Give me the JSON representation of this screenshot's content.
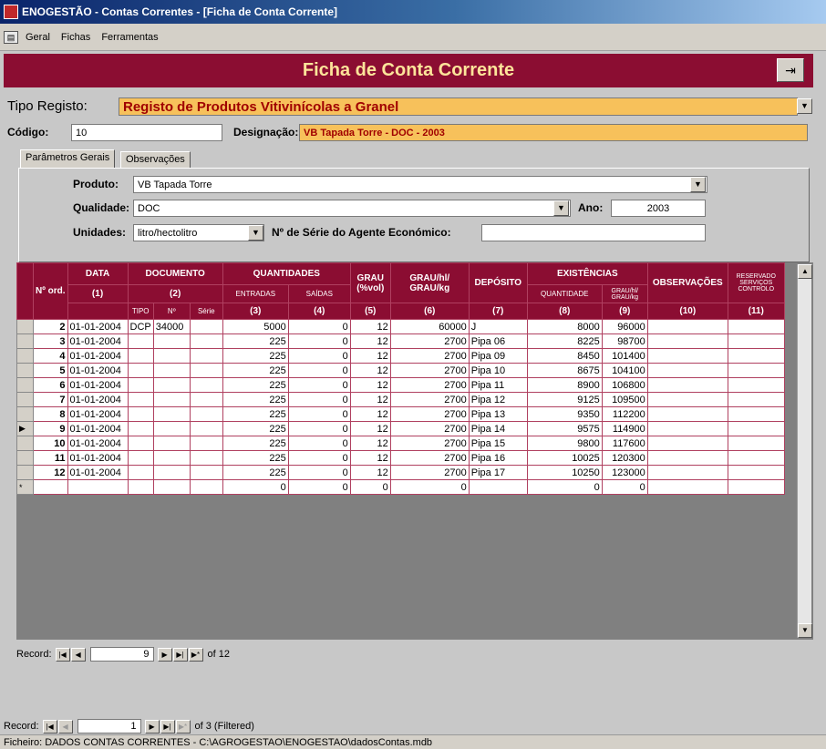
{
  "window": {
    "title": "ENOGESTÃO - Contas Correntes - [Ficha de Conta Corrente]"
  },
  "menu": [
    "Geral",
    "Fichas",
    "Ferramentas"
  ],
  "header": {
    "title": "Ficha de Conta Corrente"
  },
  "form": {
    "tipo_registo_label": "Tipo Registo:",
    "tipo_registo_value": "Registo de Produtos Vitivinícolas a Granel",
    "codigo_label": "Código:",
    "codigo_value": "10",
    "designacao_label": "Designação:",
    "designacao_value": "VB Tapada Torre - DOC - 2003"
  },
  "tabs": [
    "Parâmetros Gerais",
    "Observações"
  ],
  "params": {
    "produto_label": "Produto:",
    "produto_value": "VB Tapada Torre",
    "qualidade_label": "Qualidade:",
    "qualidade_value": "DOC",
    "ano_label": "Ano:",
    "ano_value": "2003",
    "unidades_label": "Unidades:",
    "unidades_value": "litro/hectolitro",
    "nserie_label": "Nº de Série do Agente Económico:",
    "nserie_value": ""
  },
  "grid": {
    "headers": {
      "nord": "Nº ord.",
      "data": "DATA",
      "data_num": "(1)",
      "documento": "DOCUMENTO",
      "documento_num": "(2)",
      "tipo": "TIPO",
      "n": "Nº",
      "serie": "Série",
      "quantidades": "QUANTIDADES",
      "entradas": "ENTRADAS",
      "saidas": "SAÍDAS",
      "q3": "(3)",
      "q4": "(4)",
      "grau": "GRAU (%vol)",
      "grau_num": "(5)",
      "grauhl": "GRAU/hl/ GRAU/kg",
      "grauhl_num": "(6)",
      "deposito": "DEPÓSITO",
      "deposito_num": "(7)",
      "existencias": "EXISTÊNCIAS",
      "quantidade": "QUANTIDADE",
      "grauhl2": "GRAU/hl/ GRAU/kg",
      "e8": "(8)",
      "e9": "(9)",
      "observacoes": "OBSERVAÇÕES",
      "obs_num": "(10)",
      "reservado": "RESERVADO SERVIÇOS CONTROLO",
      "res_num": "(11)"
    },
    "rows": [
      [
        "2",
        "01-01-2004",
        "DCP",
        "34000",
        "",
        "5000",
        "0",
        "12",
        "60000",
        "J",
        "8000",
        "96000",
        "",
        ""
      ],
      [
        "3",
        "01-01-2004",
        "",
        "",
        "",
        "225",
        "0",
        "12",
        "2700",
        "Pipa 06",
        "8225",
        "98700",
        "",
        ""
      ],
      [
        "4",
        "01-01-2004",
        "",
        "",
        "",
        "225",
        "0",
        "12",
        "2700",
        "Pipa 09",
        "8450",
        "101400",
        "",
        ""
      ],
      [
        "5",
        "01-01-2004",
        "",
        "",
        "",
        "225",
        "0",
        "12",
        "2700",
        "Pipa 10",
        "8675",
        "104100",
        "",
        ""
      ],
      [
        "6",
        "01-01-2004",
        "",
        "",
        "",
        "225",
        "0",
        "12",
        "2700",
        "Pipa 11",
        "8900",
        "106800",
        "",
        ""
      ],
      [
        "7",
        "01-01-2004",
        "",
        "",
        "",
        "225",
        "0",
        "12",
        "2700",
        "Pipa 12",
        "9125",
        "109500",
        "",
        ""
      ],
      [
        "8",
        "01-01-2004",
        "",
        "",
        "",
        "225",
        "0",
        "12",
        "2700",
        "Pipa 13",
        "9350",
        "112200",
        "",
        ""
      ],
      [
        "9",
        "01-01-2004",
        "",
        "",
        "",
        "225",
        "0",
        "12",
        "2700",
        "Pipa 14",
        "9575",
        "114900",
        "",
        ""
      ],
      [
        "10",
        "01-01-2004",
        "",
        "",
        "",
        "225",
        "0",
        "12",
        "2700",
        "Pipa 15",
        "9800",
        "117600",
        "",
        ""
      ],
      [
        "11",
        "01-01-2004",
        "",
        "",
        "",
        "225",
        "0",
        "12",
        "2700",
        "Pipa 16",
        "10025",
        "120300",
        "",
        ""
      ],
      [
        "12",
        "01-01-2004",
        "",
        "",
        "",
        "225",
        "0",
        "12",
        "2700",
        "Pipa 17",
        "10250",
        "123000",
        "",
        ""
      ],
      [
        "",
        "",
        "",
        "",
        "",
        "0",
        "0",
        "0",
        "0",
        "",
        "0",
        "0",
        "",
        ""
      ]
    ]
  },
  "nav_inner": {
    "label": "Record:",
    "current": "9",
    "total": "of 12"
  },
  "nav_outer": {
    "label": "Record:",
    "current": "1",
    "total": "of 3 (Filtered)"
  },
  "status": "Ficheiro: DADOS CONTAS CORRENTES - C:\\AGROGESTAO\\ENOGESTAO\\dadosContas.mdb"
}
